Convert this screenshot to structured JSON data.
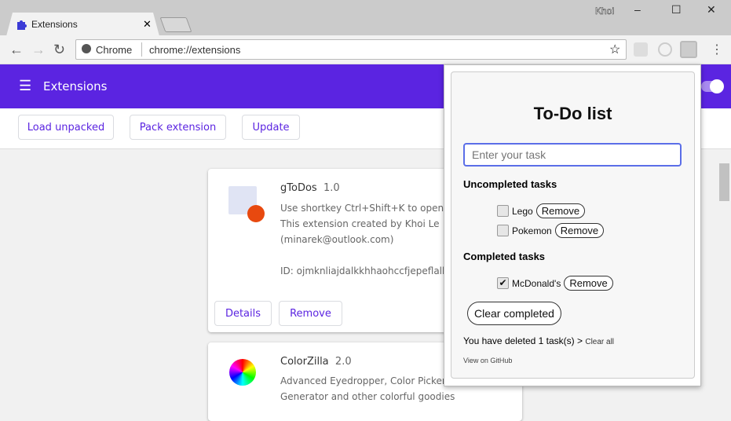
{
  "browser": {
    "tab_title": "Extensions",
    "user": "Khoi",
    "omnibox_site": "Chrome",
    "omnibox_url": "chrome://extensions"
  },
  "header": {
    "title": "Extensions"
  },
  "toolbar": {
    "load_unpacked": "Load unpacked",
    "pack_extension": "Pack extension",
    "update": "Update"
  },
  "extensions": [
    {
      "name": "gToDos",
      "version": "1.0",
      "description_lines": [
        "Use shortkey Ctrl+Shift+K to open it",
        "This extension created by Khoi Le",
        "(minarek@outlook.com)"
      ],
      "id_line": "ID: ojmknliajdalkkhhaohccfjepeflallm",
      "details": "Details",
      "remove": "Remove"
    },
    {
      "name": "ColorZilla",
      "version": "2.0",
      "description_lines": [
        "Advanced Eyedropper, Color Picker, G",
        "Generator and other colorful goodies"
      ]
    }
  ],
  "popup": {
    "title": "To-Do list",
    "input_placeholder": "Enter your task",
    "uncompleted_heading": "Uncompleted tasks",
    "uncompleted": [
      {
        "label": "Lego",
        "checked": false
      },
      {
        "label": "Pokemon",
        "checked": false
      }
    ],
    "completed_heading": "Completed tasks",
    "completed": [
      {
        "label": "McDonald's",
        "checked": true
      }
    ],
    "remove_label": "Remove",
    "clear_completed": "Clear completed",
    "deleted_text": "You have deleted 1 task(s) >",
    "clear_all": "Clear all",
    "github": "View on GitHub"
  },
  "colors": {
    "accent": "#5b24e1"
  }
}
